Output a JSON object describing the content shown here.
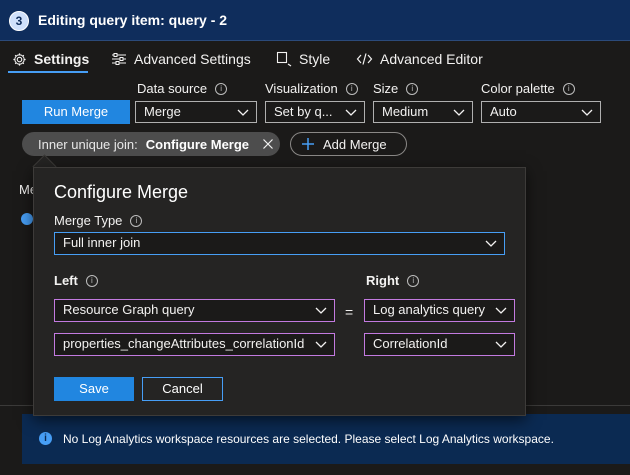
{
  "header": {
    "step_number": "3",
    "title": "Editing query item: query - 2"
  },
  "tabs": [
    {
      "label": "Settings",
      "icon": "gear-icon",
      "active": true
    },
    {
      "label": "Advanced Settings",
      "icon": "sliders-icon",
      "active": false
    },
    {
      "label": "Style",
      "icon": "style-icon",
      "active": false
    },
    {
      "label": "Advanced Editor",
      "icon": "code-icon",
      "active": false
    }
  ],
  "toolbar": {
    "run_merge_label": "Run Merge",
    "data_source": {
      "label": "Data source",
      "value": "Merge"
    },
    "visualization": {
      "label": "Visualization",
      "value": "Set by q..."
    },
    "size": {
      "label": "Size",
      "value": "Medium"
    },
    "color_palette": {
      "label": "Color palette",
      "value": "Auto"
    }
  },
  "merge_pill": {
    "prefix": "Inner unique join:",
    "name": "Configure Merge"
  },
  "add_merge_label": "Add Merge",
  "background": {
    "partial_label": "Me"
  },
  "configure_merge": {
    "title": "Configure Merge",
    "merge_type_label": "Merge Type",
    "merge_type_value": "Full inner join",
    "left_label": "Left",
    "right_label": "Right",
    "left_query": "Resource Graph query",
    "right_query": "Log analytics query",
    "equals": "=",
    "left_column": "properties_changeAttributes_correlationId",
    "right_column": "CorrelationId",
    "save_label": "Save",
    "cancel_label": "Cancel"
  },
  "message_bar": {
    "text": "No Log Analytics workspace resources are selected. Please select Log Analytics workspace."
  },
  "colors": {
    "title_bar": "#0f2d5c",
    "accent": "#2186e0",
    "focus": "#479ef5",
    "validation": "#c37ae0",
    "message_bar": "#0b2a52"
  }
}
